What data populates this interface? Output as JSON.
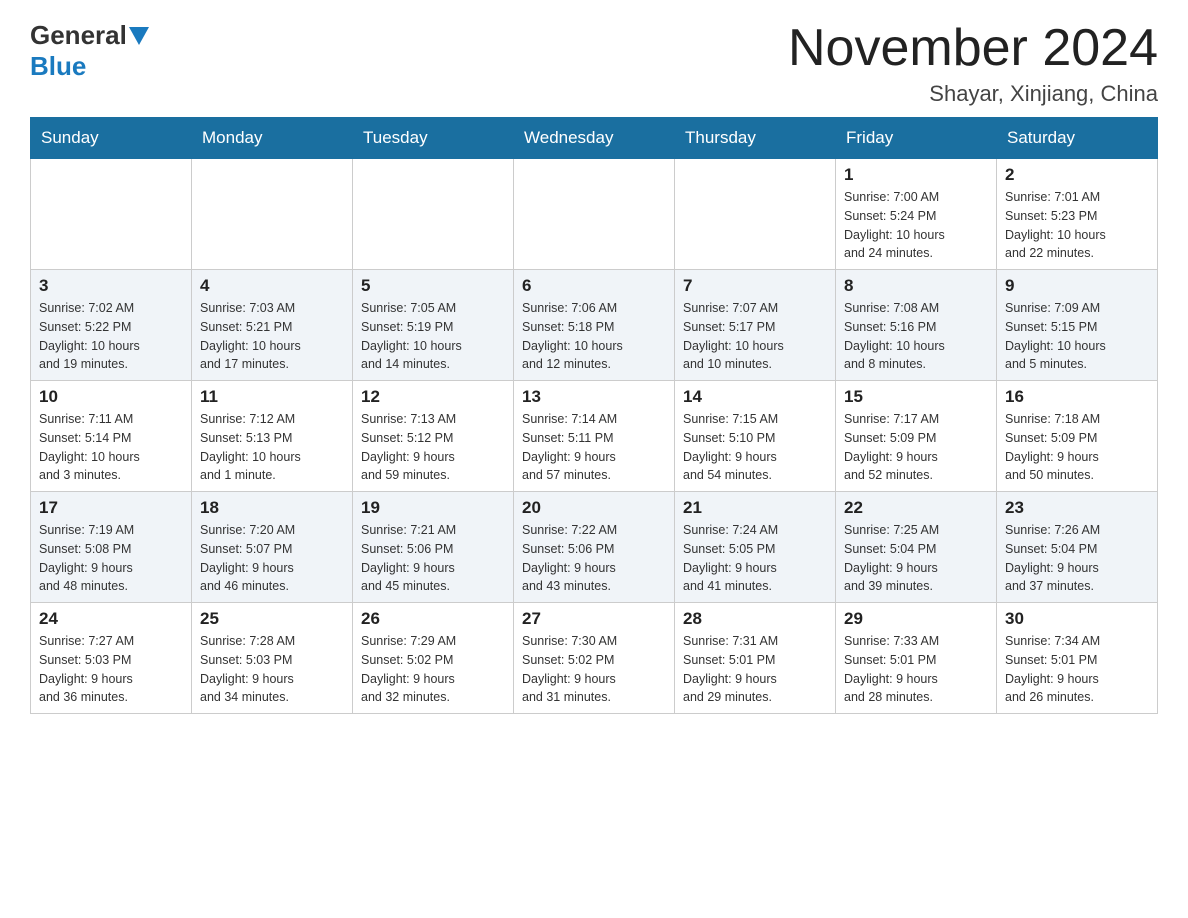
{
  "header": {
    "logo_general": "General",
    "logo_blue": "Blue",
    "title": "November 2024",
    "subtitle": "Shayar, Xinjiang, China"
  },
  "days_of_week": [
    "Sunday",
    "Monday",
    "Tuesday",
    "Wednesday",
    "Thursday",
    "Friday",
    "Saturday"
  ],
  "weeks": [
    {
      "days": [
        {
          "num": "",
          "info": ""
        },
        {
          "num": "",
          "info": ""
        },
        {
          "num": "",
          "info": ""
        },
        {
          "num": "",
          "info": ""
        },
        {
          "num": "",
          "info": ""
        },
        {
          "num": "1",
          "info": "Sunrise: 7:00 AM\nSunset: 5:24 PM\nDaylight: 10 hours\nand 24 minutes."
        },
        {
          "num": "2",
          "info": "Sunrise: 7:01 AM\nSunset: 5:23 PM\nDaylight: 10 hours\nand 22 minutes."
        }
      ]
    },
    {
      "days": [
        {
          "num": "3",
          "info": "Sunrise: 7:02 AM\nSunset: 5:22 PM\nDaylight: 10 hours\nand 19 minutes."
        },
        {
          "num": "4",
          "info": "Sunrise: 7:03 AM\nSunset: 5:21 PM\nDaylight: 10 hours\nand 17 minutes."
        },
        {
          "num": "5",
          "info": "Sunrise: 7:05 AM\nSunset: 5:19 PM\nDaylight: 10 hours\nand 14 minutes."
        },
        {
          "num": "6",
          "info": "Sunrise: 7:06 AM\nSunset: 5:18 PM\nDaylight: 10 hours\nand 12 minutes."
        },
        {
          "num": "7",
          "info": "Sunrise: 7:07 AM\nSunset: 5:17 PM\nDaylight: 10 hours\nand 10 minutes."
        },
        {
          "num": "8",
          "info": "Sunrise: 7:08 AM\nSunset: 5:16 PM\nDaylight: 10 hours\nand 8 minutes."
        },
        {
          "num": "9",
          "info": "Sunrise: 7:09 AM\nSunset: 5:15 PM\nDaylight: 10 hours\nand 5 minutes."
        }
      ]
    },
    {
      "days": [
        {
          "num": "10",
          "info": "Sunrise: 7:11 AM\nSunset: 5:14 PM\nDaylight: 10 hours\nand 3 minutes."
        },
        {
          "num": "11",
          "info": "Sunrise: 7:12 AM\nSunset: 5:13 PM\nDaylight: 10 hours\nand 1 minute."
        },
        {
          "num": "12",
          "info": "Sunrise: 7:13 AM\nSunset: 5:12 PM\nDaylight: 9 hours\nand 59 minutes."
        },
        {
          "num": "13",
          "info": "Sunrise: 7:14 AM\nSunset: 5:11 PM\nDaylight: 9 hours\nand 57 minutes."
        },
        {
          "num": "14",
          "info": "Sunrise: 7:15 AM\nSunset: 5:10 PM\nDaylight: 9 hours\nand 54 minutes."
        },
        {
          "num": "15",
          "info": "Sunrise: 7:17 AM\nSunset: 5:09 PM\nDaylight: 9 hours\nand 52 minutes."
        },
        {
          "num": "16",
          "info": "Sunrise: 7:18 AM\nSunset: 5:09 PM\nDaylight: 9 hours\nand 50 minutes."
        }
      ]
    },
    {
      "days": [
        {
          "num": "17",
          "info": "Sunrise: 7:19 AM\nSunset: 5:08 PM\nDaylight: 9 hours\nand 48 minutes."
        },
        {
          "num": "18",
          "info": "Sunrise: 7:20 AM\nSunset: 5:07 PM\nDaylight: 9 hours\nand 46 minutes."
        },
        {
          "num": "19",
          "info": "Sunrise: 7:21 AM\nSunset: 5:06 PM\nDaylight: 9 hours\nand 45 minutes."
        },
        {
          "num": "20",
          "info": "Sunrise: 7:22 AM\nSunset: 5:06 PM\nDaylight: 9 hours\nand 43 minutes."
        },
        {
          "num": "21",
          "info": "Sunrise: 7:24 AM\nSunset: 5:05 PM\nDaylight: 9 hours\nand 41 minutes."
        },
        {
          "num": "22",
          "info": "Sunrise: 7:25 AM\nSunset: 5:04 PM\nDaylight: 9 hours\nand 39 minutes."
        },
        {
          "num": "23",
          "info": "Sunrise: 7:26 AM\nSunset: 5:04 PM\nDaylight: 9 hours\nand 37 minutes."
        }
      ]
    },
    {
      "days": [
        {
          "num": "24",
          "info": "Sunrise: 7:27 AM\nSunset: 5:03 PM\nDaylight: 9 hours\nand 36 minutes."
        },
        {
          "num": "25",
          "info": "Sunrise: 7:28 AM\nSunset: 5:03 PM\nDaylight: 9 hours\nand 34 minutes."
        },
        {
          "num": "26",
          "info": "Sunrise: 7:29 AM\nSunset: 5:02 PM\nDaylight: 9 hours\nand 32 minutes."
        },
        {
          "num": "27",
          "info": "Sunrise: 7:30 AM\nSunset: 5:02 PM\nDaylight: 9 hours\nand 31 minutes."
        },
        {
          "num": "28",
          "info": "Sunrise: 7:31 AM\nSunset: 5:01 PM\nDaylight: 9 hours\nand 29 minutes."
        },
        {
          "num": "29",
          "info": "Sunrise: 7:33 AM\nSunset: 5:01 PM\nDaylight: 9 hours\nand 28 minutes."
        },
        {
          "num": "30",
          "info": "Sunrise: 7:34 AM\nSunset: 5:01 PM\nDaylight: 9 hours\nand 26 minutes."
        }
      ]
    }
  ]
}
